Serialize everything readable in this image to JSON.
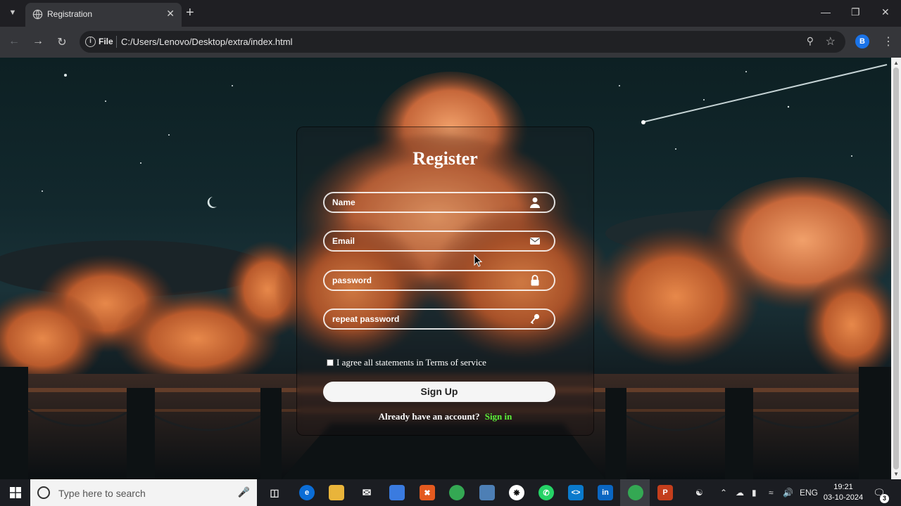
{
  "browser": {
    "tab_title": "Registration",
    "address_scheme": "File",
    "address_url": "C:/Users/Lenovo/Desktop/extra/index.html",
    "profile_initial": "B"
  },
  "form": {
    "title": "Register",
    "name_placeholder": "Name",
    "email_placeholder": "Email",
    "password_placeholder": "password",
    "repeat_placeholder": "repeat password",
    "agree_text": "I agree all statements in Terms of service",
    "signup_label": "Sign Up",
    "signin_prompt": "Already have an account?",
    "signin_link": "Sign in",
    "link_color": "#5cf03a"
  },
  "taskbar": {
    "search_placeholder": "Type here to search",
    "language": "ENG",
    "time": "19:21",
    "date": "03-10-2024",
    "notification_count": "3"
  }
}
